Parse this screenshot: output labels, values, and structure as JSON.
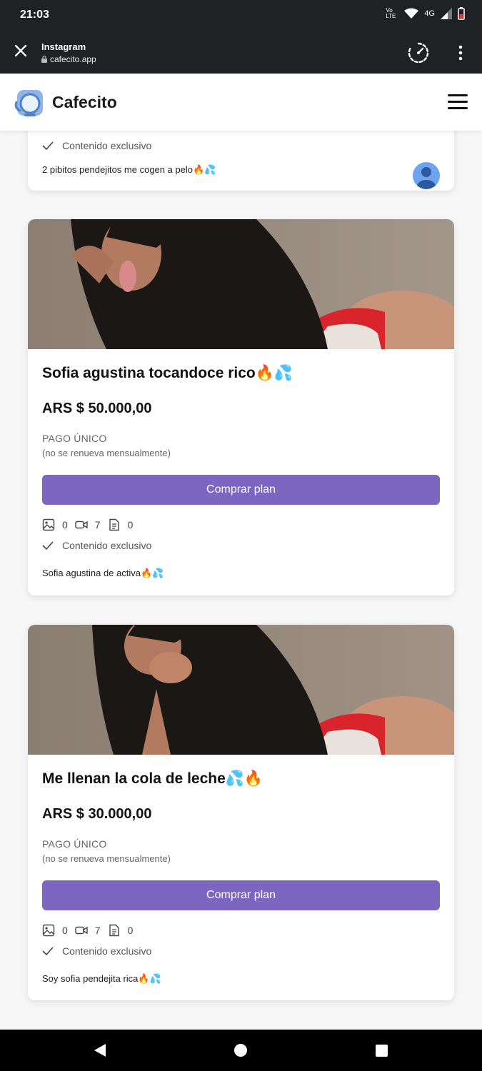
{
  "status_bar": {
    "time": "21:03",
    "network": "4G",
    "volte": "Vo LTE"
  },
  "browser": {
    "source_app": "Instagram",
    "url": "cafecito.app"
  },
  "site": {
    "brand": "Cafecito"
  },
  "cards": [
    {
      "exclusive_label": "Contenido exclusivo",
      "description": "2 pibitos pendejitos me cogen a pelo🔥💦"
    },
    {
      "title": "Sofia agustina tocandoce rico🔥💦",
      "price": "ARS $ 50.000,00",
      "pay_type": "PAGO ÚNICO",
      "pay_note": "(no se renueva mensualmente)",
      "buy_label": "Comprar plan",
      "images": "0",
      "videos": "7",
      "documents": "0",
      "exclusive_label": "Contenido exclusivo",
      "description": "Sofia agustina de activa🔥💦"
    },
    {
      "title": "Me llenan la cola de leche💦🔥",
      "price": "ARS $ 30.000,00",
      "pay_type": "PAGO ÚNICO",
      "pay_note": "(no se renueva mensualmente)",
      "buy_label": "Comprar plan",
      "images": "0",
      "videos": "7",
      "documents": "0",
      "exclusive_label": "Contenido exclusivo",
      "description": "Soy sofia pendejita rica🔥💦"
    }
  ],
  "colors": {
    "accent": "#7c66c2",
    "topbar": "#202124",
    "avatar": "#6ea3ef"
  }
}
